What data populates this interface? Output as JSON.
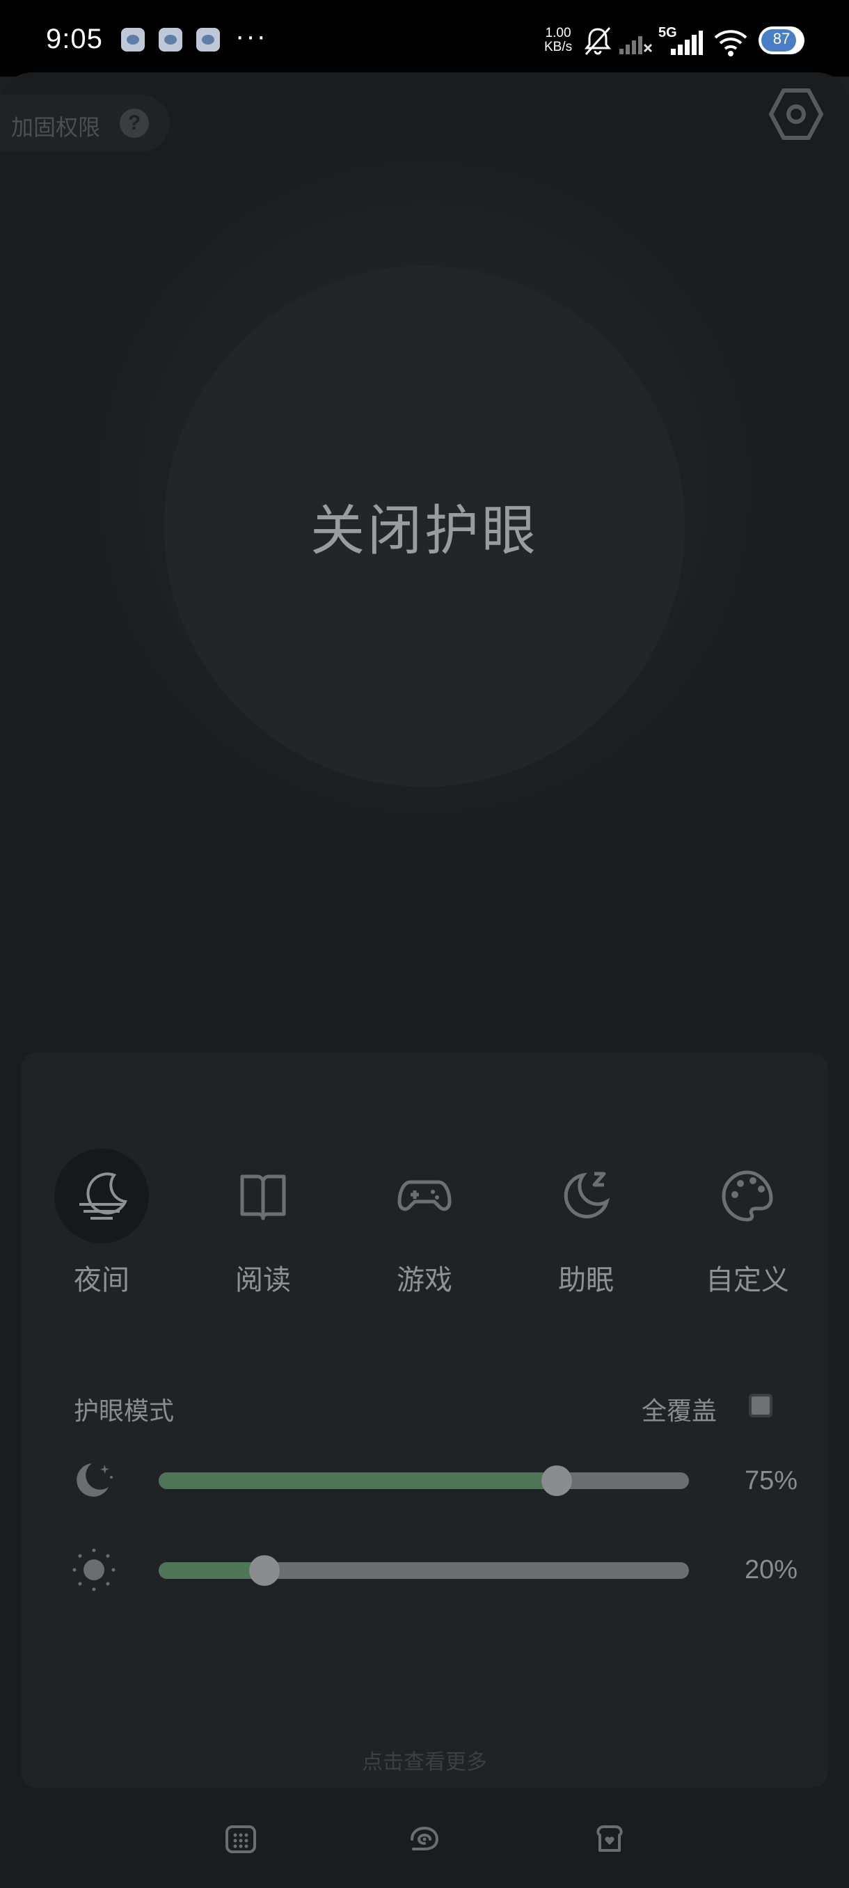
{
  "status_bar": {
    "time": "9:05",
    "more": "···",
    "speed_value": "1.00",
    "speed_unit": "KB/s",
    "network": "5G",
    "battery": "87",
    "icons": [
      "app-notification-icon",
      "bell-muted-icon",
      "signal-icon",
      "signal-5g-icon",
      "wifi-icon",
      "battery-icon"
    ]
  },
  "header": {
    "permission_label": "加固权限",
    "help_symbol": "?",
    "settings_icon": "hexagon-settings-icon"
  },
  "main": {
    "toggle_label": "关闭护眼"
  },
  "modes": [
    {
      "label": "夜间",
      "icon": "moon-night-icon",
      "active": true
    },
    {
      "label": "阅读",
      "icon": "book-icon",
      "active": false
    },
    {
      "label": "游戏",
      "icon": "gamepad-icon",
      "active": false
    },
    {
      "label": "助眠",
      "icon": "moon-sleep-icon",
      "active": false
    },
    {
      "label": "自定义",
      "icon": "palette-icon",
      "active": false
    }
  ],
  "eye_mode": {
    "title": "护眼模式",
    "full_cover_label": "全覆盖",
    "full_cover_checked": false
  },
  "sliders": [
    {
      "icon": "moon-filter-icon",
      "value": 75,
      "label": "75%"
    },
    {
      "icon": "brightness-icon",
      "value": 20,
      "label": "20%"
    }
  ],
  "more_link": "点击查看更多",
  "bottom_nav": [
    "grid-icon",
    "swirl-icon",
    "toast-heart-icon"
  ],
  "colors": {
    "accent": "#4e7656",
    "background": "#1a1d1f",
    "panel": "#1f2326"
  }
}
